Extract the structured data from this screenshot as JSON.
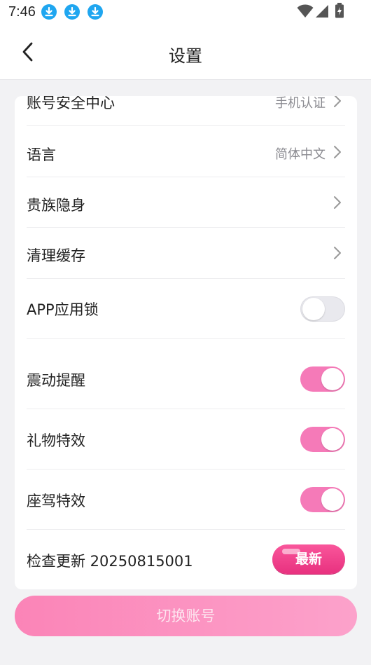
{
  "status_bar": {
    "time": "7:46",
    "notification_icons": [
      "download-icon",
      "download-icon",
      "download-icon"
    ],
    "system_icons": [
      "wifi-icon",
      "signal-icon",
      "battery-charging-icon"
    ]
  },
  "header": {
    "title": "设置",
    "back_icon": "chevron-left-icon"
  },
  "settings": {
    "account_security": {
      "label": "账号安全中心",
      "value": "手机认证"
    },
    "language": {
      "label": "语言",
      "value": "简体中文"
    },
    "noble_invisible": {
      "label": "贵族隐身"
    },
    "clear_cache": {
      "label": "清理缓存"
    },
    "app_lock": {
      "label": "APP应用锁",
      "enabled": false
    },
    "vibration": {
      "label": "震动提醒",
      "enabled": true
    },
    "gift_effects": {
      "label": "礼物特效",
      "enabled": true
    },
    "mount_effects": {
      "label": "座驾特效",
      "enabled": true
    },
    "check_update": {
      "label": "检查更新 20250815001",
      "badge": "最新"
    }
  },
  "switch_account": {
    "label": "切换账号"
  },
  "colors": {
    "accent_pink": "#f57ab8",
    "badge_pink": "#e8317f",
    "button_gradient_start": "#fb84b7",
    "button_gradient_end": "#fca2cb",
    "background": "#f2f2f4"
  }
}
